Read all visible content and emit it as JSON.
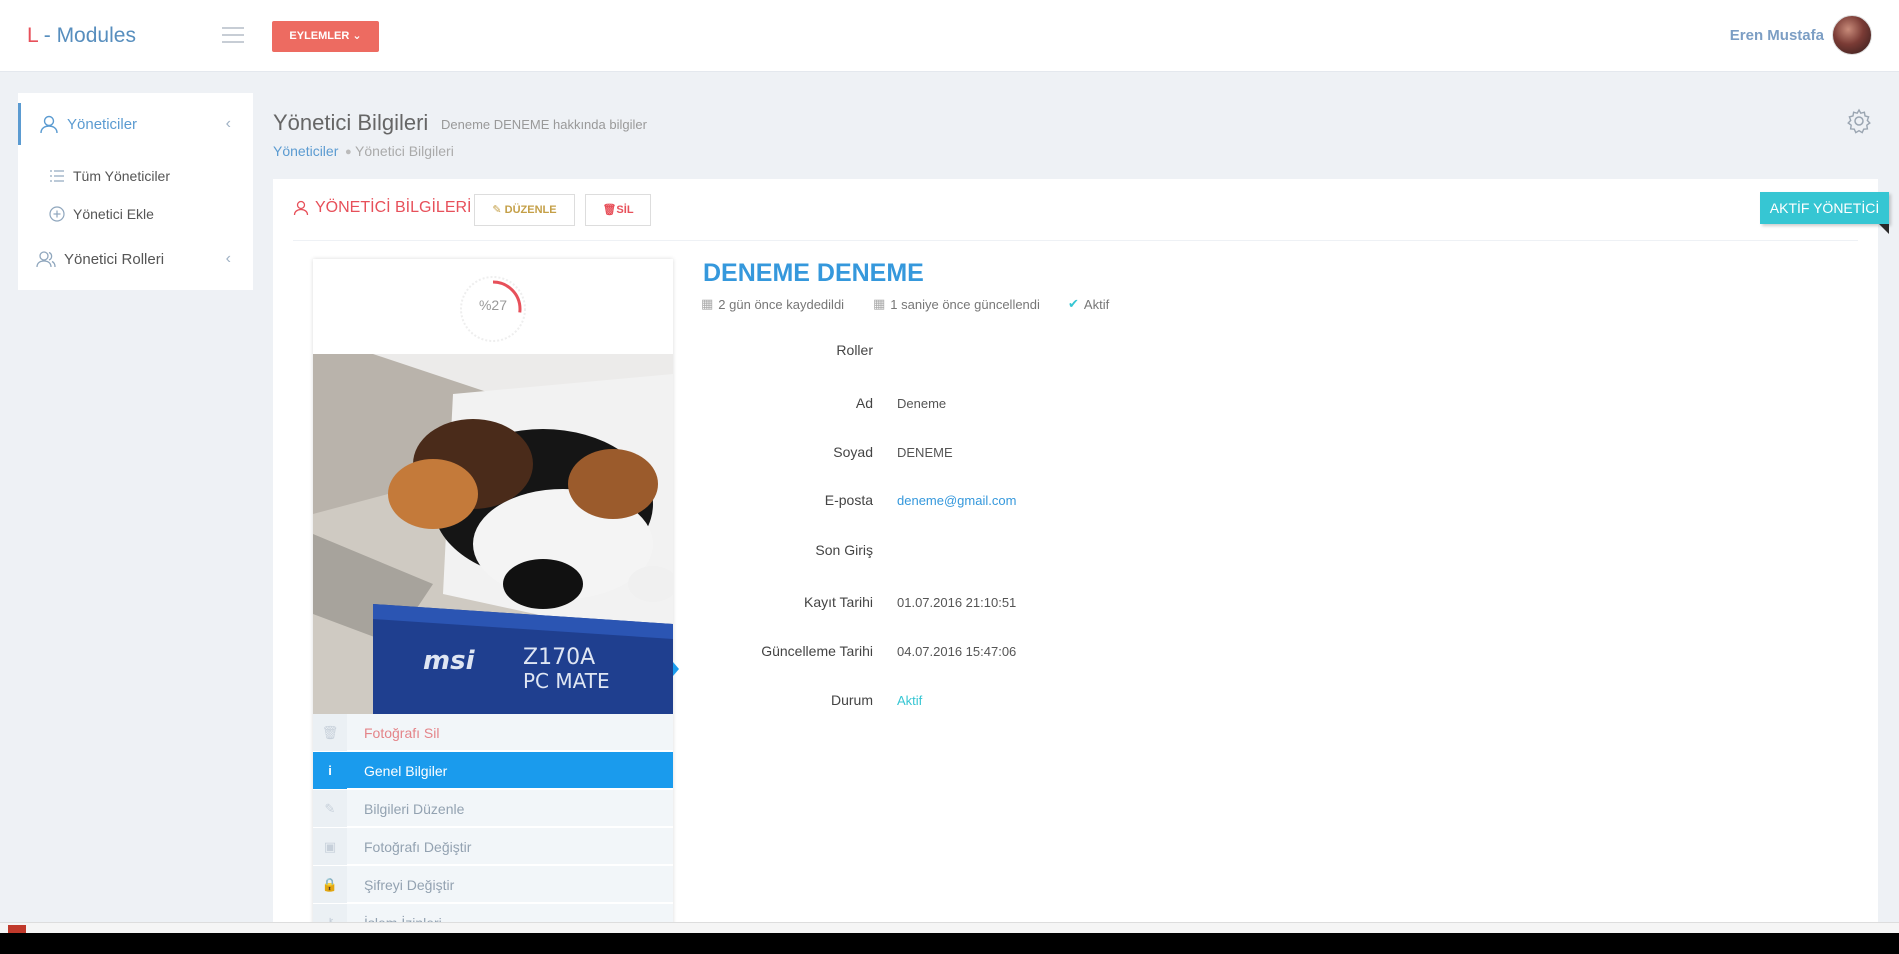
{
  "header": {
    "logo_prefix": "L",
    "logo_rest": " - Modules",
    "actions_label": "EYLEMLER ⌄",
    "user_name": "Eren Mustafa"
  },
  "sidebar": {
    "items": [
      {
        "label": "Yöneticiler",
        "icon": "user-icon",
        "active": true
      },
      {
        "label": "Tüm Yöneticiler",
        "icon": "list-icon"
      },
      {
        "label": "Yönetici Ekle",
        "icon": "plus-circle-icon"
      },
      {
        "label": "Yönetici Rolleri",
        "icon": "users-icon"
      }
    ]
  },
  "page": {
    "title": "Yönetici Bilgileri",
    "subtitle": "Deneme DENEME hakkında bilgiler",
    "breadcrumb": [
      "Yöneticiler",
      "Yönetici Bilgileri"
    ]
  },
  "portlet": {
    "title": "YÖNETİCİ BİLGİLERİ",
    "edit_label": "DÜZENLE",
    "delete_label": "SİL",
    "ribbon": "AKTİF YÖNETİCİ"
  },
  "profile": {
    "completion": "%27",
    "completion_fraction": 0.27,
    "menu": [
      {
        "label": "Fotoğrafı Sil",
        "icon": "trash-icon"
      },
      {
        "label": "Genel Bilgiler",
        "icon": "info-icon",
        "active": true
      },
      {
        "label": "Bilgileri Düzenle",
        "icon": "pencil-icon"
      },
      {
        "label": "Fotoğrafı Değiştir",
        "icon": "image-icon"
      },
      {
        "label": "Şifreyi Değiştir",
        "icon": "lock-icon"
      },
      {
        "label": "İşlem İzinleri",
        "icon": "key-icon"
      }
    ]
  },
  "details": {
    "full_name": "DENEME DENEME",
    "created": "2 gün önce kaydedildi",
    "updated": "1 saniye önce güncellendi",
    "status_badge": "Aktif",
    "fields": [
      {
        "label": "Roller",
        "value": ""
      },
      {
        "label": "Ad",
        "value": "Deneme"
      },
      {
        "label": "Soyad",
        "value": "DENEME"
      },
      {
        "label": "E-posta",
        "value": "deneme@gmail.com"
      },
      {
        "label": "Son Giriş",
        "value": ""
      },
      {
        "label": "Kayıt Tarihi",
        "value": "01.07.2016 21:10:51"
      },
      {
        "label": "Güncelleme Tarihi",
        "value": "04.07.2016 15:47:06"
      },
      {
        "label": "Durum",
        "value": "Aktif"
      }
    ]
  },
  "colors": {
    "primary": "#3598dc",
    "danger": "#e7505a",
    "accent": "#36c6d3",
    "active_menu": "#1a9bed"
  }
}
